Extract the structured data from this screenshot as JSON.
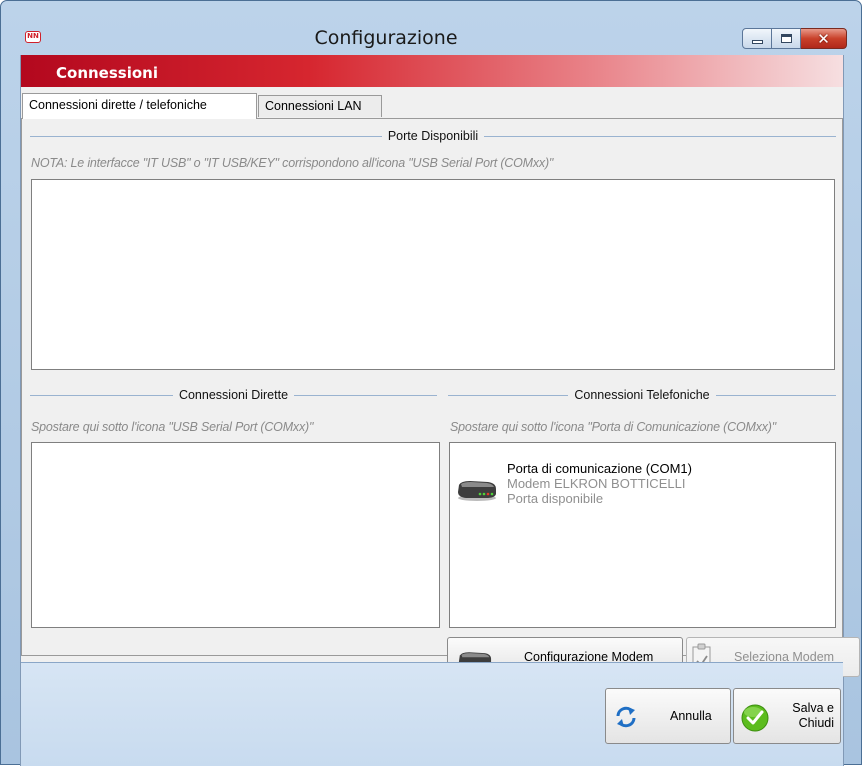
{
  "window": {
    "app_icon_text": "NN",
    "title": "Configurazione"
  },
  "section": {
    "title": "Connessioni"
  },
  "tabs": [
    {
      "label": "Connessioni dirette / telefoniche",
      "active": true
    },
    {
      "label": "Connessioni LAN",
      "active": false
    }
  ],
  "porte": {
    "group_label": "Porte Disponibili",
    "note": "NOTA: Le interfacce \"IT USB\" o \"IT USB/KEY\" corrispondono all'icona \"USB Serial Port (COMxx)\""
  },
  "dirette": {
    "group_label": "Connessioni Dirette",
    "hint": "Spostare qui sotto l'icona \"USB Serial Port (COMxx)\""
  },
  "telefoniche": {
    "group_label": "Connessioni Telefoniche",
    "hint": "Spostare qui sotto l'icona \"Porta di Comunicazione (COMxx)\"",
    "items": [
      {
        "name": "Porta di comunicazione (COM1)",
        "modem": "Modem ELKRON BOTTICELLI",
        "status": "Porta disponibile"
      }
    ]
  },
  "buttons": {
    "config_modem": "Configurazione Modem",
    "seleziona_modem": "Seleziona Modem",
    "annulla": "Annulla",
    "salva_line1": "Salva e",
    "salva_line2": "Chiudi"
  },
  "colors": {
    "header_red": "#b3081e",
    "window_frame": "#a9c4e0",
    "close_red": "#c9412a",
    "ok_green": "#5cbc1e",
    "refresh_blue": "#1f6fc5"
  },
  "icons": {
    "app": "nn-logo-icon",
    "modem": "modem-icon",
    "seleziona": "checklist-icon",
    "annulla": "refresh-arrows-icon",
    "salva": "green-check-icon"
  }
}
